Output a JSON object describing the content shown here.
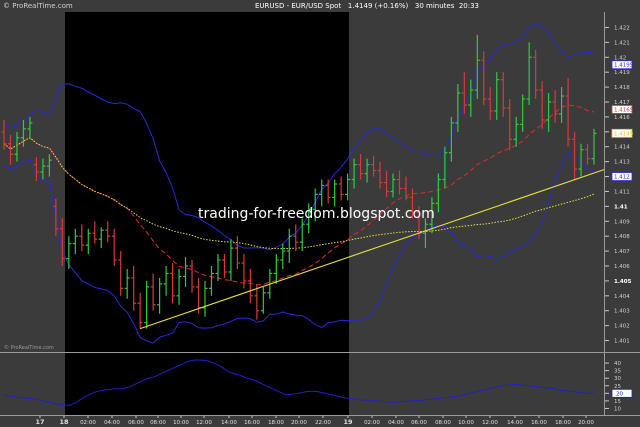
{
  "header": {
    "brand": "© ProRealTime.com",
    "instrument": "EURUSD - EUR/USD Spot",
    "last_price": "1.4149",
    "change": "(+0.16%)",
    "timeframe": "30 minutes",
    "time": "20:33"
  },
  "watermark": "trading-for-freedom.blogspot.com",
  "footer_credit": "© ProRealTime.com",
  "colors": {
    "background": "#3a3a3a",
    "session_shade": "#000000",
    "bull_bar": "#2ecc40",
    "bear_bar": "#d63a3a",
    "bollinger": "#2a2ad8",
    "ma_red": "#e02a2a",
    "ma_yellow": "#e8e23a",
    "trendline": "#e8e23a",
    "osc_line": "#2020c8"
  },
  "chart_data": [
    {
      "type": "line",
      "title": "",
      "series_kind": "ohlc-bars",
      "x_tick_labels": [
        "17",
        "18",
        "02:00",
        "04:00",
        "06:00",
        "08:00",
        "10:00",
        "12:00",
        "14:00",
        "16:00",
        "18:00",
        "20:00",
        "22:00",
        "19",
        "02:00",
        "04:00",
        "06:00",
        "08:00",
        "10:00",
        "12:00",
        "14:00",
        "16:00",
        "18:00",
        "20:00"
      ],
      "y_tick_labels": [
        "1.401",
        "1.402",
        "1.403",
        "1.404",
        "1.405",
        "1.406",
        "1.407",
        "1.408",
        "1.409",
        "1.41",
        "1.411",
        "1.412",
        "1.413",
        "1.414",
        "1.415",
        "1.416",
        "1.417",
        "1.418",
        "1.419",
        "1.42",
        "1.421",
        "1.422"
      ],
      "ylim": [
        1.4005,
        1.4225
      ],
      "price_tags": [
        "1.4195",
        "1.4165",
        "1.4149",
        "1.412"
      ],
      "bar_step_minutes": 30,
      "bars": [
        {
          "o": 1.415,
          "h": 1.4158,
          "l": 1.4138,
          "c": 1.4142
        },
        {
          "o": 1.4142,
          "h": 1.4148,
          "l": 1.4128,
          "c": 1.4135
        },
        {
          "o": 1.4135,
          "h": 1.415,
          "l": 1.413,
          "c": 1.4146
        },
        {
          "o": 1.4146,
          "h": 1.4158,
          "l": 1.414,
          "c": 1.4152
        },
        {
          "o": 1.4152,
          "h": 1.416,
          "l": 1.4145,
          "c": 1.4156
        },
        {
          "o": 1.4128,
          "h": 1.4133,
          "l": 1.4117,
          "c": 1.4123
        },
        {
          "o": 1.4123,
          "h": 1.4132,
          "l": 1.4118,
          "c": 1.4127
        },
        {
          "o": 1.4127,
          "h": 1.4135,
          "l": 1.412,
          "c": 1.4131
        },
        {
          "o": 1.41,
          "h": 1.4105,
          "l": 1.408,
          "c": 1.4085
        },
        {
          "o": 1.4085,
          "h": 1.4092,
          "l": 1.406,
          "c": 1.4065
        },
        {
          "o": 1.4065,
          "h": 1.408,
          "l": 1.4058,
          "c": 1.4075
        },
        {
          "o": 1.4075,
          "h": 1.4085,
          "l": 1.4068,
          "c": 1.408
        },
        {
          "o": 1.408,
          "h": 1.4088,
          "l": 1.407,
          "c": 1.4074
        },
        {
          "o": 1.4074,
          "h": 1.4085,
          "l": 1.4068,
          "c": 1.4082
        },
        {
          "o": 1.4082,
          "h": 1.409,
          "l": 1.4075,
          "c": 1.4078
        },
        {
          "o": 1.4078,
          "h": 1.4086,
          "l": 1.4072,
          "c": 1.4084
        },
        {
          "o": 1.4084,
          "h": 1.409,
          "l": 1.4076,
          "c": 1.408
        },
        {
          "o": 1.408,
          "h": 1.4085,
          "l": 1.406,
          "c": 1.4064
        },
        {
          "o": 1.4064,
          "h": 1.407,
          "l": 1.404,
          "c": 1.4045
        },
        {
          "o": 1.4045,
          "h": 1.4058,
          "l": 1.4038,
          "c": 1.4052
        },
        {
          "o": 1.4052,
          "h": 1.406,
          "l": 1.403,
          "c": 1.4035
        },
        {
          "o": 1.4035,
          "h": 1.4042,
          "l": 1.4018,
          "c": 1.4022
        },
        {
          "o": 1.4022,
          "h": 1.405,
          "l": 1.4018,
          "c": 1.4046
        },
        {
          "o": 1.4046,
          "h": 1.4055,
          "l": 1.403,
          "c": 1.4034
        },
        {
          "o": 1.4034,
          "h": 1.4052,
          "l": 1.4028,
          "c": 1.4048
        },
        {
          "o": 1.4048,
          "h": 1.406,
          "l": 1.404,
          "c": 1.4055
        },
        {
          "o": 1.4055,
          "h": 1.4062,
          "l": 1.4035,
          "c": 1.404
        },
        {
          "o": 1.404,
          "h": 1.4058,
          "l": 1.4034,
          "c": 1.4053
        },
        {
          "o": 1.4053,
          "h": 1.4066,
          "l": 1.4046,
          "c": 1.406
        },
        {
          "o": 1.406,
          "h": 1.4064,
          "l": 1.4042,
          "c": 1.4046
        },
        {
          "o": 1.4046,
          "h": 1.4052,
          "l": 1.4028,
          "c": 1.4032
        },
        {
          "o": 1.4032,
          "h": 1.405,
          "l": 1.4026,
          "c": 1.4045
        },
        {
          "o": 1.4045,
          "h": 1.406,
          "l": 1.404,
          "c": 1.4055
        },
        {
          "o": 1.4055,
          "h": 1.4068,
          "l": 1.405,
          "c": 1.4064
        },
        {
          "o": 1.4064,
          "h": 1.4068,
          "l": 1.4052,
          "c": 1.4056
        },
        {
          "o": 1.4056,
          "h": 1.4078,
          "l": 1.405,
          "c": 1.4072
        },
        {
          "o": 1.4072,
          "h": 1.408,
          "l": 1.4058,
          "c": 1.4062
        },
        {
          "o": 1.4062,
          "h": 1.4068,
          "l": 1.4045,
          "c": 1.405
        },
        {
          "o": 1.405,
          "h": 1.4058,
          "l": 1.4035,
          "c": 1.404
        },
        {
          "o": 1.404,
          "h": 1.4048,
          "l": 1.4024,
          "c": 1.403
        },
        {
          "o": 1.403,
          "h": 1.4046,
          "l": 1.4028,
          "c": 1.4042
        },
        {
          "o": 1.4042,
          "h": 1.4058,
          "l": 1.4038,
          "c": 1.4055
        },
        {
          "o": 1.4055,
          "h": 1.4068,
          "l": 1.4048,
          "c": 1.4064
        },
        {
          "o": 1.4064,
          "h": 1.4075,
          "l": 1.4058,
          "c": 1.407
        },
        {
          "o": 1.407,
          "h": 1.4085,
          "l": 1.4062,
          "c": 1.408
        },
        {
          "o": 1.408,
          "h": 1.4088,
          "l": 1.407,
          "c": 1.4076
        },
        {
          "o": 1.4076,
          "h": 1.4092,
          "l": 1.407,
          "c": 1.4088
        },
        {
          "o": 1.4088,
          "h": 1.4102,
          "l": 1.4082,
          "c": 1.4098
        },
        {
          "o": 1.4098,
          "h": 1.4112,
          "l": 1.409,
          "c": 1.4108
        },
        {
          "o": 1.4108,
          "h": 1.4118,
          "l": 1.41,
          "c": 1.4114
        },
        {
          "o": 1.4114,
          "h": 1.4118,
          "l": 1.4102,
          "c": 1.4106
        },
        {
          "o": 1.4106,
          "h": 1.4118,
          "l": 1.41,
          "c": 1.4115
        },
        {
          "o": 1.4115,
          "h": 1.412,
          "l": 1.4104,
          "c": 1.4108
        },
        {
          "o": 1.4108,
          "h": 1.4122,
          "l": 1.4104,
          "c": 1.4118
        },
        {
          "o": 1.4118,
          "h": 1.4132,
          "l": 1.4112,
          "c": 1.4128
        },
        {
          "o": 1.4128,
          "h": 1.4135,
          "l": 1.4118,
          "c": 1.4122
        },
        {
          "o": 1.4122,
          "h": 1.4132,
          "l": 1.4116,
          "c": 1.4128
        },
        {
          "o": 1.4128,
          "h": 1.4134,
          "l": 1.412,
          "c": 1.4124
        },
        {
          "o": 1.4124,
          "h": 1.413,
          "l": 1.4112,
          "c": 1.4116
        },
        {
          "o": 1.4116,
          "h": 1.4124,
          "l": 1.4106,
          "c": 1.411
        },
        {
          "o": 1.411,
          "h": 1.4122,
          "l": 1.4106,
          "c": 1.4118
        },
        {
          "o": 1.4118,
          "h": 1.4124,
          "l": 1.4108,
          "c": 1.4112
        },
        {
          "o": 1.4112,
          "h": 1.412,
          "l": 1.4104,
          "c": 1.4106
        },
        {
          "o": 1.4106,
          "h": 1.4112,
          "l": 1.4092,
          "c": 1.4096
        },
        {
          "o": 1.4096,
          "h": 1.41,
          "l": 1.4078,
          "c": 1.4082
        },
        {
          "o": 1.4082,
          "h": 1.4092,
          "l": 1.4072,
          "c": 1.4088
        },
        {
          "o": 1.4088,
          "h": 1.4106,
          "l": 1.4082,
          "c": 1.4102
        },
        {
          "o": 1.4102,
          "h": 1.4122,
          "l": 1.4096,
          "c": 1.4118
        },
        {
          "o": 1.4118,
          "h": 1.414,
          "l": 1.4112,
          "c": 1.4136
        },
        {
          "o": 1.4136,
          "h": 1.416,
          "l": 1.413,
          "c": 1.4156
        },
        {
          "o": 1.4156,
          "h": 1.4182,
          "l": 1.415,
          "c": 1.4176
        },
        {
          "o": 1.4176,
          "h": 1.419,
          "l": 1.4162,
          "c": 1.4168
        },
        {
          "o": 1.4168,
          "h": 1.4185,
          "l": 1.416,
          "c": 1.4178
        },
        {
          "o": 1.4178,
          "h": 1.4215,
          "l": 1.4172,
          "c": 1.4198
        },
        {
          "o": 1.4198,
          "h": 1.4204,
          "l": 1.4168,
          "c": 1.4172
        },
        {
          "o": 1.4172,
          "h": 1.418,
          "l": 1.4158,
          "c": 1.4164
        },
        {
          "o": 1.4164,
          "h": 1.419,
          "l": 1.4158,
          "c": 1.4185
        },
        {
          "o": 1.4185,
          "h": 1.419,
          "l": 1.416,
          "c": 1.4166
        },
        {
          "o": 1.4166,
          "h": 1.4172,
          "l": 1.4138,
          "c": 1.4145
        },
        {
          "o": 1.4145,
          "h": 1.416,
          "l": 1.414,
          "c": 1.4155
        },
        {
          "o": 1.4155,
          "h": 1.4175,
          "l": 1.415,
          "c": 1.4172
        },
        {
          "o": 1.4172,
          "h": 1.421,
          "l": 1.4168,
          "c": 1.42
        },
        {
          "o": 1.42,
          "h": 1.4205,
          "l": 1.4172,
          "c": 1.4178
        },
        {
          "o": 1.4178,
          "h": 1.4184,
          "l": 1.4152,
          "c": 1.4158
        },
        {
          "o": 1.4158,
          "h": 1.4176,
          "l": 1.415,
          "c": 1.417
        },
        {
          "o": 1.417,
          "h": 1.4178,
          "l": 1.4156,
          "c": 1.4162
        },
        {
          "o": 1.4162,
          "h": 1.418,
          "l": 1.4156,
          "c": 1.4174
        },
        {
          "o": 1.4174,
          "h": 1.4186,
          "l": 1.414,
          "c": 1.4145
        },
        {
          "o": 1.4145,
          "h": 1.415,
          "l": 1.4118,
          "c": 1.4125
        },
        {
          "o": 1.4125,
          "h": 1.4142,
          "l": 1.412,
          "c": 1.4138
        },
        {
          "o": 1.4138,
          "h": 1.4142,
          "l": 1.4128,
          "c": 1.4132
        },
        {
          "o": 1.4132,
          "h": 1.4152,
          "l": 1.4128,
          "c": 1.4149
        }
      ]
    },
    {
      "type": "line",
      "title": "",
      "y_tick_labels": [
        "10",
        "15",
        "20",
        "25",
        "30",
        "35",
        "40"
      ],
      "ylim": [
        7,
        44
      ],
      "last_value_tag": "20",
      "values": [
        19,
        18,
        17.5,
        17,
        16.5,
        16,
        15,
        14,
        13,
        12.5,
        12,
        14,
        17,
        19,
        21,
        22,
        22.5,
        23,
        23,
        24,
        26,
        28,
        30,
        31,
        33,
        35,
        37,
        39,
        41,
        42,
        42,
        41.5,
        40,
        38,
        35,
        33,
        32,
        30,
        29,
        27,
        25,
        23,
        21,
        19,
        19.5,
        20,
        21,
        21.5,
        21,
        20,
        19,
        18,
        17,
        16.5,
        16,
        15.5,
        15,
        15,
        14.5,
        14,
        14,
        14.5,
        15,
        15,
        15.5,
        16,
        16.5,
        17,
        17.5,
        18,
        19,
        20,
        21,
        22,
        23,
        24,
        25,
        25.5,
        26,
        25.5,
        25,
        24.5,
        24,
        23.5,
        23,
        22,
        21.5,
        21,
        20.5,
        20,
        20
      ]
    }
  ]
}
